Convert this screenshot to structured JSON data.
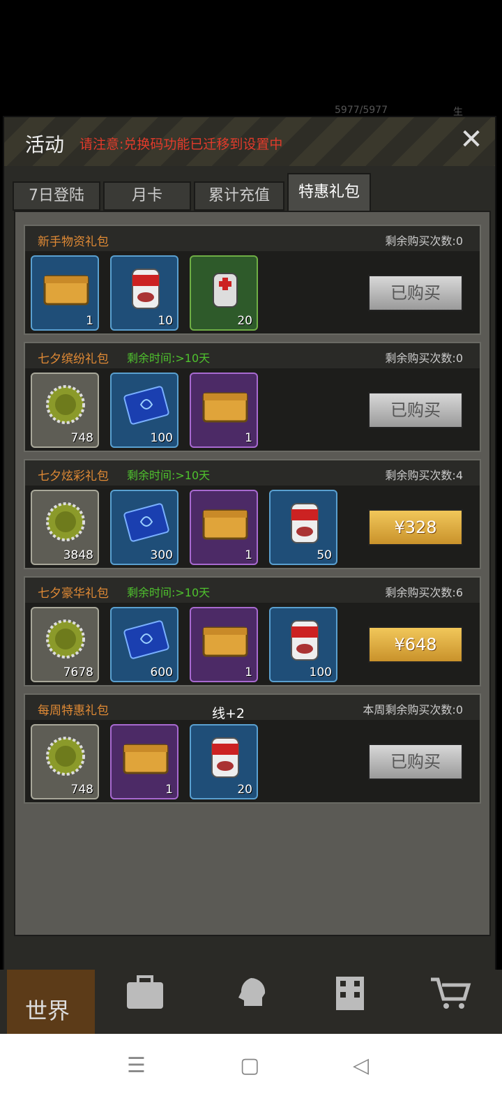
{
  "status": {
    "hp": "5977/5977",
    "label": "生命"
  },
  "dialog": {
    "title": "活动",
    "notice": "请注意:兑换码功能已迁移到设置中",
    "close_icon": "close-icon"
  },
  "tabs": [
    {
      "label": "7日登陆",
      "active": false
    },
    {
      "label": "月卡",
      "active": false
    },
    {
      "label": "累计充值",
      "active": false
    },
    {
      "label": "特惠礼包",
      "active": true
    }
  ],
  "packs": [
    {
      "name": "新手物资礼包",
      "time": "",
      "remain": "剩余购买次数:0",
      "items": [
        {
          "icon": "crate-icon",
          "rarity": "blue",
          "qty": "1"
        },
        {
          "icon": "meat-can-icon",
          "rarity": "blue",
          "qty": "10"
        },
        {
          "icon": "medkit-can-icon",
          "rarity": "green",
          "qty": "20"
        }
      ],
      "button": {
        "label": "已购买",
        "state": "purchased"
      }
    },
    {
      "name": "七夕缤纷礼包",
      "time": "剩余时间:>10天",
      "remain": "剩余购买次数:0",
      "items": [
        {
          "icon": "bottle-cap-icon",
          "rarity": "gray",
          "qty": "748"
        },
        {
          "icon": "qixi-card-icon",
          "rarity": "blue",
          "qty": "100"
        },
        {
          "icon": "crate-icon",
          "rarity": "purple",
          "qty": "1"
        }
      ],
      "button": {
        "label": "已购买",
        "state": "purchased"
      }
    },
    {
      "name": "七夕炫彩礼包",
      "time": "剩余时间:>10天",
      "remain": "剩余购买次数:4",
      "items": [
        {
          "icon": "bottle-cap-icon",
          "rarity": "gray",
          "qty": "3848"
        },
        {
          "icon": "qixi-card-icon",
          "rarity": "blue",
          "qty": "300"
        },
        {
          "icon": "crate-icon",
          "rarity": "purple",
          "qty": "1"
        },
        {
          "icon": "meat-can-icon",
          "rarity": "blue",
          "qty": "50"
        }
      ],
      "button": {
        "label": "¥328",
        "state": "buy"
      }
    },
    {
      "name": "七夕豪华礼包",
      "time": "剩余时间:>10天",
      "remain": "剩余购买次数:6",
      "items": [
        {
          "icon": "bottle-cap-icon",
          "rarity": "gray",
          "qty": "7678"
        },
        {
          "icon": "qixi-card-icon",
          "rarity": "blue",
          "qty": "600"
        },
        {
          "icon": "crate-icon",
          "rarity": "purple",
          "qty": "1"
        },
        {
          "icon": "meat-can-icon",
          "rarity": "blue",
          "qty": "100"
        }
      ],
      "button": {
        "label": "¥648",
        "state": "buy"
      }
    },
    {
      "name": "每周特惠礼包",
      "time": "",
      "remain": "本周剩余购买次数:0",
      "items": [
        {
          "icon": "bottle-cap-icon",
          "rarity": "gray",
          "qty": "748"
        },
        {
          "icon": "crate-icon",
          "rarity": "purple",
          "qty": "1"
        },
        {
          "icon": "meat-can-icon",
          "rarity": "blue",
          "qty": "20"
        }
      ],
      "button": {
        "label": "已购买",
        "state": "purchased"
      }
    }
  ],
  "floating_text": "线+2",
  "bottom_nav": [
    {
      "label": "世界",
      "icon": "globe-icon",
      "active": true
    },
    {
      "label": "",
      "icon": "backpack-icon",
      "active": false
    },
    {
      "label": "",
      "icon": "head-icon",
      "active": false
    },
    {
      "label": "",
      "icon": "building-icon",
      "active": false
    },
    {
      "label": "",
      "icon": "cart-icon",
      "active": false
    }
  ],
  "system_nav": [
    "menu-icon",
    "home-icon",
    "back-icon"
  ]
}
